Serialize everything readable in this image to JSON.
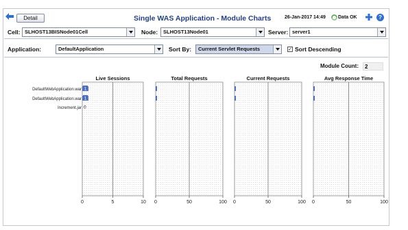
{
  "header": {
    "detail_label": "Detail",
    "title": "Single WAS Application - Module Charts",
    "timestamp": "26-Jan-2017 14:49",
    "status_label": "Data OK",
    "icons": [
      "back-arrow-icon",
      "data-ok-icon",
      "add-icon",
      "help-icon"
    ],
    "accent_color": "#22408a"
  },
  "filters": {
    "cell_label": "Cell:",
    "cell_value": "SLHOST13BISNode01Cell",
    "node_label": "Node:",
    "node_value": "SLHOST13Node01",
    "server_label": "Server:",
    "server_value": "server1",
    "application_label": "Application:",
    "application_value": "DefaultApplication",
    "sort_label": "Sort By:",
    "sort_value": "Current Servlet Requests",
    "sort_descending_label": "Sort Descending",
    "sort_descending_checked": true
  },
  "summary": {
    "module_count_label": "Module Count:",
    "module_count_value": "2"
  },
  "chart_data": [
    {
      "type": "bar",
      "title": "Live Sessions",
      "categories": [
        "DefaultWebApplication.war",
        "DefaultWebApplication.war",
        "Increment.jar"
      ],
      "values": [
        1,
        1,
        0
      ],
      "data_labels": [
        "1",
        "1",
        "0"
      ],
      "xlim": [
        0,
        10
      ],
      "ticks": [
        "0",
        "5",
        "10"
      ],
      "orientation": "horizontal"
    },
    {
      "type": "bar",
      "title": "Total Requests",
      "categories": [
        "DefaultWebApplication.war",
        "DefaultWebApplication.war",
        "Increment.jar"
      ],
      "values": [
        1,
        1,
        0
      ],
      "xlim": [
        0,
        100
      ],
      "ticks": [
        "0",
        "50",
        "100"
      ],
      "orientation": "horizontal"
    },
    {
      "type": "bar",
      "title": "Current Requests",
      "categories": [
        "DefaultWebApplication.war",
        "DefaultWebApplication.war",
        "Increment.jar"
      ],
      "values": [
        1,
        1,
        0
      ],
      "xlim": [
        0,
        100
      ],
      "ticks": [
        "0",
        "50",
        "100"
      ],
      "orientation": "horizontal"
    },
    {
      "type": "bar",
      "title": "Avg Response Time",
      "categories": [
        "DefaultWebApplication.war",
        "DefaultWebApplication.war",
        "Increment.jar"
      ],
      "values": [
        1,
        1,
        0
      ],
      "xlim": [
        0,
        100
      ],
      "ticks": [
        "0",
        "50",
        "100"
      ],
      "orientation": "horizontal"
    }
  ],
  "colors": {
    "bar": "#4a6fc7",
    "bar_label_bg": "#4a6fc7"
  }
}
